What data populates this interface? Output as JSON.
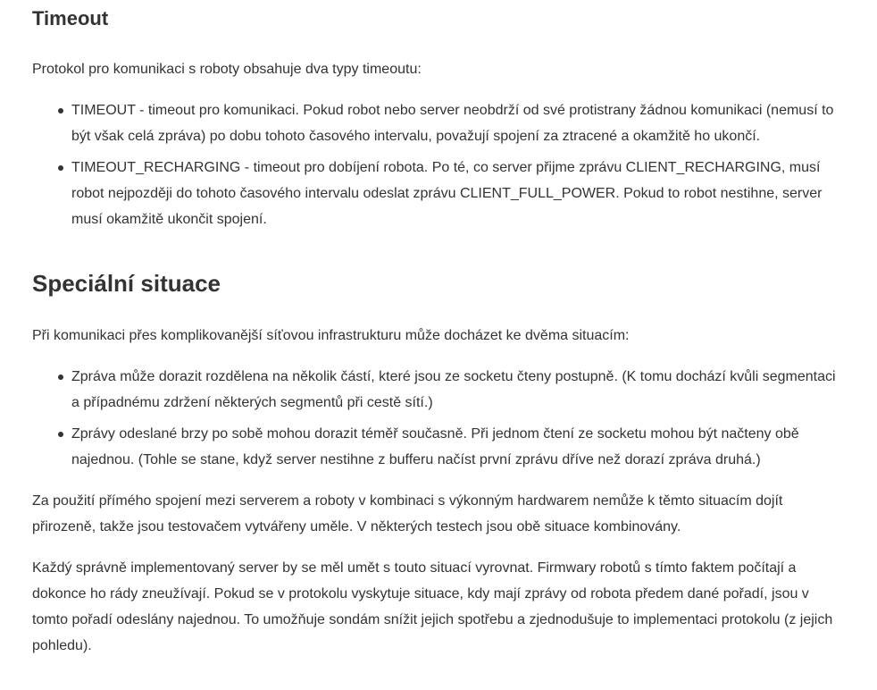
{
  "timeout": {
    "heading": "Timeout",
    "intro": "Protokol pro komunikaci s roboty obsahuje dva typy timeoutu:",
    "items": [
      "TIMEOUT - timeout pro komunikaci. Pokud robot nebo server neobdrží od své protistrany žádnou komunikaci (nemusí to být však celá zpráva) po dobu tohoto časového intervalu, považují spojení za ztracené a okamžitě ho ukončí.",
      "TIMEOUT_RECHARGING - timeout pro dobíjení robota. Po té, co server přijme zprávu CLIENT_RECHARGING, musí robot nejpozději do tohoto časového intervalu odeslat zprávu CLIENT_FULL_POWER. Pokud to robot nestihne, server musí okamžitě ukončit spojení."
    ]
  },
  "special": {
    "heading": "Speciální situace",
    "intro": "Při komunikaci přes komplikovanější síťovou infrastrukturu může docházet ke dvěma situacím:",
    "items": [
      "Zpráva může dorazit rozdělena na několik částí, které jsou ze socketu čteny postupně. (K tomu dochází kvůli segmentaci a případnému zdržení některých segmentů při cestě sítí.)",
      "Zprávy odeslané brzy po sobě mohou dorazit téměř současně. Při jednom čtení ze socketu mohou být načteny obě najednou. (Tohle se stane, když server nestihne z bufferu načíst první zprávu dříve než dorazí zpráva druhá.)"
    ],
    "paragraph1": "Za použití přímého spojení mezi serverem a roboty v kombinaci s výkonným hardwarem nemůže k těmto situacím dojít přirozeně, takže jsou testovačem vytvářeny uměle. V některých testech jsou obě situace kombinovány.",
    "paragraph2": "Každý správně implementovaný server by se měl umět s touto situací vyrovnat. Firmwary robotů s tímto faktem počítají a dokonce ho rády zneužívají. Pokud se v protokolu vyskytuje situace, kdy mají zprávy od robota předem dané pořadí, jsou v tomto pořadí odeslány najednou. To umožňuje sondám snížit jejich spotřebu a zjednodušuje to implementaci protokolu (z jejich pohledu)."
  }
}
